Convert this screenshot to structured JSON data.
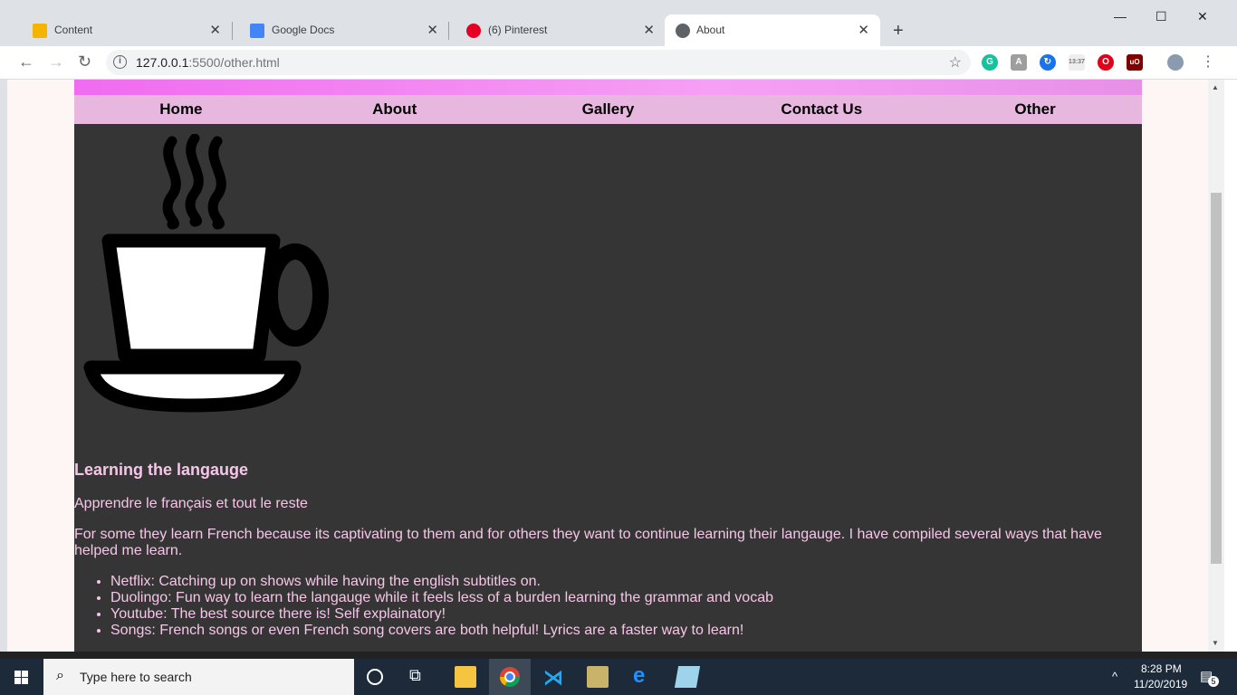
{
  "browser": {
    "tabs": [
      {
        "title": "Content",
        "favicon": "slides-icon",
        "color": "#f4b400"
      },
      {
        "title": "Google Docs",
        "favicon": "docs-icon",
        "color": "#4285f4"
      },
      {
        "title": "(6) Pinterest",
        "favicon": "pinterest-icon",
        "color": "#e60023"
      },
      {
        "title": "About",
        "favicon": "globe-icon",
        "color": "#5f6368",
        "active": true
      }
    ],
    "url_host": "127.0.0.1",
    "url_rest": ":5500/other.html"
  },
  "site": {
    "nav": [
      "Home",
      "About",
      "Gallery",
      "Contact Us",
      "Other"
    ],
    "heading": "Learning the langauge",
    "subtitle": "Apprendre le français et tout le reste",
    "intro": "For some they learn French because its captivating to them and for others they want to continue learning their langauge. I have compiled several ways that have helped me learn.",
    "list": [
      "Netflix: Catching up on shows while having the english subtitles on.",
      "Duolingo: Fun way to learn the langauge while it feels less of a burden learning the grammar and vocab",
      "Youtube: The best source there is! Self explainatory!",
      "Songs: French songs or even French song covers are both helpful! Lyrics are a faster way to learn!"
    ]
  },
  "taskbar": {
    "search_placeholder": "Type here to search",
    "time": "8:28 PM",
    "date": "11/20/2019",
    "notifications": "5"
  }
}
